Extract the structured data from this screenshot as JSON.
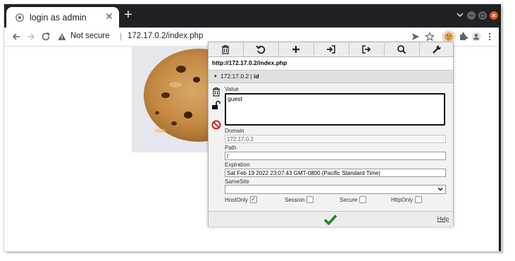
{
  "browser": {
    "tab_title": "login as admin",
    "new_tab_symbol": "+",
    "close_symbol": "✕",
    "security_label": "Not secure",
    "separator": "|",
    "url": "172.17.0.2/index.php"
  },
  "icons": [
    "globe-icon",
    "close-icon",
    "new-tab-icon",
    "tab-list-icon",
    "minimize-icon",
    "maximize-icon",
    "window-close-icon",
    "back-icon",
    "forward-icon",
    "reload-icon",
    "warning-icon",
    "send-icon",
    "star-icon",
    "cookie-extension-icon",
    "puzzle-icon",
    "profile-icon",
    "more-icon",
    "trash-icon",
    "undo-icon",
    "plus-icon",
    "import-icon",
    "export-icon",
    "search-icon",
    "wrench-icon",
    "unlock-icon",
    "block-icon",
    "check-icon"
  ],
  "colors": {
    "titlebar": "#202124",
    "accent_orange": "#e8a33c",
    "check_green": "#1f8b2c",
    "block_red": "#d0201b"
  },
  "cookie_editor": {
    "page_url": "http://172.17.0.2/index.php",
    "cookie_host": "172.17.0.2",
    "cookie_sep": " | ",
    "cookie_name": "id",
    "caret": "▾",
    "value_label": "Value",
    "value": "guest",
    "domain_label": "Domain",
    "domain": "172.17.0.2",
    "path_label": "Path",
    "path": "/",
    "expiration_label": "Expiration",
    "expiration": "Sat Feb 19 2022 23:07:43 GMT-0800 (Pacific Standard Time)",
    "samesite_label": "SameSite",
    "samesite_value": "",
    "hostonly_label": "HostOnly",
    "hostonly_checked": true,
    "session_label": "Session",
    "session_checked": false,
    "secure_label": "Secure",
    "secure_checked": false,
    "httponly_label": "HttpOnly",
    "httponly_checked": false,
    "check_mark": "✓",
    "help_label": "Help"
  }
}
